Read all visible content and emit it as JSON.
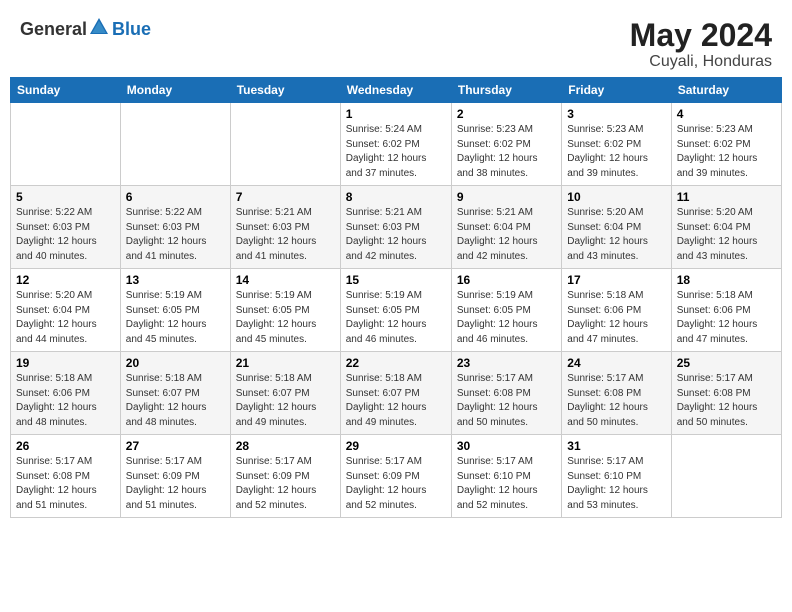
{
  "logo": {
    "general": "General",
    "blue": "Blue"
  },
  "title": "May 2024",
  "subtitle": "Cuyali, Honduras",
  "days_of_week": [
    "Sunday",
    "Monday",
    "Tuesday",
    "Wednesday",
    "Thursday",
    "Friday",
    "Saturday"
  ],
  "weeks": [
    [
      {
        "day": "",
        "info": ""
      },
      {
        "day": "",
        "info": ""
      },
      {
        "day": "",
        "info": ""
      },
      {
        "day": "1",
        "info": "Sunrise: 5:24 AM\nSunset: 6:02 PM\nDaylight: 12 hours\nand 37 minutes."
      },
      {
        "day": "2",
        "info": "Sunrise: 5:23 AM\nSunset: 6:02 PM\nDaylight: 12 hours\nand 38 minutes."
      },
      {
        "day": "3",
        "info": "Sunrise: 5:23 AM\nSunset: 6:02 PM\nDaylight: 12 hours\nand 39 minutes."
      },
      {
        "day": "4",
        "info": "Sunrise: 5:23 AM\nSunset: 6:02 PM\nDaylight: 12 hours\nand 39 minutes."
      }
    ],
    [
      {
        "day": "5",
        "info": "Sunrise: 5:22 AM\nSunset: 6:03 PM\nDaylight: 12 hours\nand 40 minutes."
      },
      {
        "day": "6",
        "info": "Sunrise: 5:22 AM\nSunset: 6:03 PM\nDaylight: 12 hours\nand 41 minutes."
      },
      {
        "day": "7",
        "info": "Sunrise: 5:21 AM\nSunset: 6:03 PM\nDaylight: 12 hours\nand 41 minutes."
      },
      {
        "day": "8",
        "info": "Sunrise: 5:21 AM\nSunset: 6:03 PM\nDaylight: 12 hours\nand 42 minutes."
      },
      {
        "day": "9",
        "info": "Sunrise: 5:21 AM\nSunset: 6:04 PM\nDaylight: 12 hours\nand 42 minutes."
      },
      {
        "day": "10",
        "info": "Sunrise: 5:20 AM\nSunset: 6:04 PM\nDaylight: 12 hours\nand 43 minutes."
      },
      {
        "day": "11",
        "info": "Sunrise: 5:20 AM\nSunset: 6:04 PM\nDaylight: 12 hours\nand 43 minutes."
      }
    ],
    [
      {
        "day": "12",
        "info": "Sunrise: 5:20 AM\nSunset: 6:04 PM\nDaylight: 12 hours\nand 44 minutes."
      },
      {
        "day": "13",
        "info": "Sunrise: 5:19 AM\nSunset: 6:05 PM\nDaylight: 12 hours\nand 45 minutes."
      },
      {
        "day": "14",
        "info": "Sunrise: 5:19 AM\nSunset: 6:05 PM\nDaylight: 12 hours\nand 45 minutes."
      },
      {
        "day": "15",
        "info": "Sunrise: 5:19 AM\nSunset: 6:05 PM\nDaylight: 12 hours\nand 46 minutes."
      },
      {
        "day": "16",
        "info": "Sunrise: 5:19 AM\nSunset: 6:05 PM\nDaylight: 12 hours\nand 46 minutes."
      },
      {
        "day": "17",
        "info": "Sunrise: 5:18 AM\nSunset: 6:06 PM\nDaylight: 12 hours\nand 47 minutes."
      },
      {
        "day": "18",
        "info": "Sunrise: 5:18 AM\nSunset: 6:06 PM\nDaylight: 12 hours\nand 47 minutes."
      }
    ],
    [
      {
        "day": "19",
        "info": "Sunrise: 5:18 AM\nSunset: 6:06 PM\nDaylight: 12 hours\nand 48 minutes."
      },
      {
        "day": "20",
        "info": "Sunrise: 5:18 AM\nSunset: 6:07 PM\nDaylight: 12 hours\nand 48 minutes."
      },
      {
        "day": "21",
        "info": "Sunrise: 5:18 AM\nSunset: 6:07 PM\nDaylight: 12 hours\nand 49 minutes."
      },
      {
        "day": "22",
        "info": "Sunrise: 5:18 AM\nSunset: 6:07 PM\nDaylight: 12 hours\nand 49 minutes."
      },
      {
        "day": "23",
        "info": "Sunrise: 5:17 AM\nSunset: 6:08 PM\nDaylight: 12 hours\nand 50 minutes."
      },
      {
        "day": "24",
        "info": "Sunrise: 5:17 AM\nSunset: 6:08 PM\nDaylight: 12 hours\nand 50 minutes."
      },
      {
        "day": "25",
        "info": "Sunrise: 5:17 AM\nSunset: 6:08 PM\nDaylight: 12 hours\nand 50 minutes."
      }
    ],
    [
      {
        "day": "26",
        "info": "Sunrise: 5:17 AM\nSunset: 6:08 PM\nDaylight: 12 hours\nand 51 minutes."
      },
      {
        "day": "27",
        "info": "Sunrise: 5:17 AM\nSunset: 6:09 PM\nDaylight: 12 hours\nand 51 minutes."
      },
      {
        "day": "28",
        "info": "Sunrise: 5:17 AM\nSunset: 6:09 PM\nDaylight: 12 hours\nand 52 minutes."
      },
      {
        "day": "29",
        "info": "Sunrise: 5:17 AM\nSunset: 6:09 PM\nDaylight: 12 hours\nand 52 minutes."
      },
      {
        "day": "30",
        "info": "Sunrise: 5:17 AM\nSunset: 6:10 PM\nDaylight: 12 hours\nand 52 minutes."
      },
      {
        "day": "31",
        "info": "Sunrise: 5:17 AM\nSunset: 6:10 PM\nDaylight: 12 hours\nand 53 minutes."
      },
      {
        "day": "",
        "info": ""
      }
    ]
  ]
}
